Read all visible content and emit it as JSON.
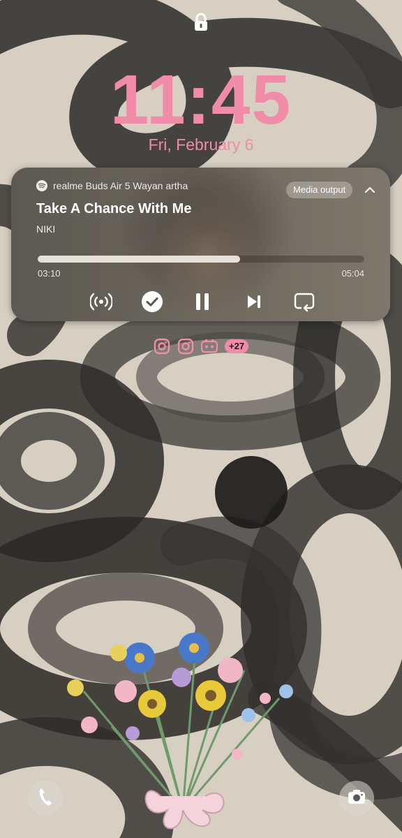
{
  "status": {
    "lock_icon": "lock-icon"
  },
  "lockscreen": {
    "time": "11:45",
    "date": "Fri, February 6",
    "accent_color": "#f08ca8"
  },
  "media": {
    "app_icon": "spotify-icon",
    "source": "realme Buds  Air 5 Wayan artha",
    "output_label": "Media output",
    "title": "Take A Chance With Me",
    "artist": "NIKI",
    "elapsed": "03:10",
    "total": "05:04",
    "progress": 0.62,
    "controls": [
      {
        "name": "broadcast-icon"
      },
      {
        "name": "check-circle-icon"
      },
      {
        "name": "pause-icon"
      },
      {
        "name": "skip-next-icon"
      },
      {
        "name": "repeat-icon"
      }
    ]
  },
  "notifications": {
    "icons": [
      "instagram-icon",
      "instagram-icon",
      "tiktok-icon"
    ],
    "more": "+27"
  },
  "shortcuts": {
    "left": "phone-icon",
    "right": "camera-icon"
  }
}
